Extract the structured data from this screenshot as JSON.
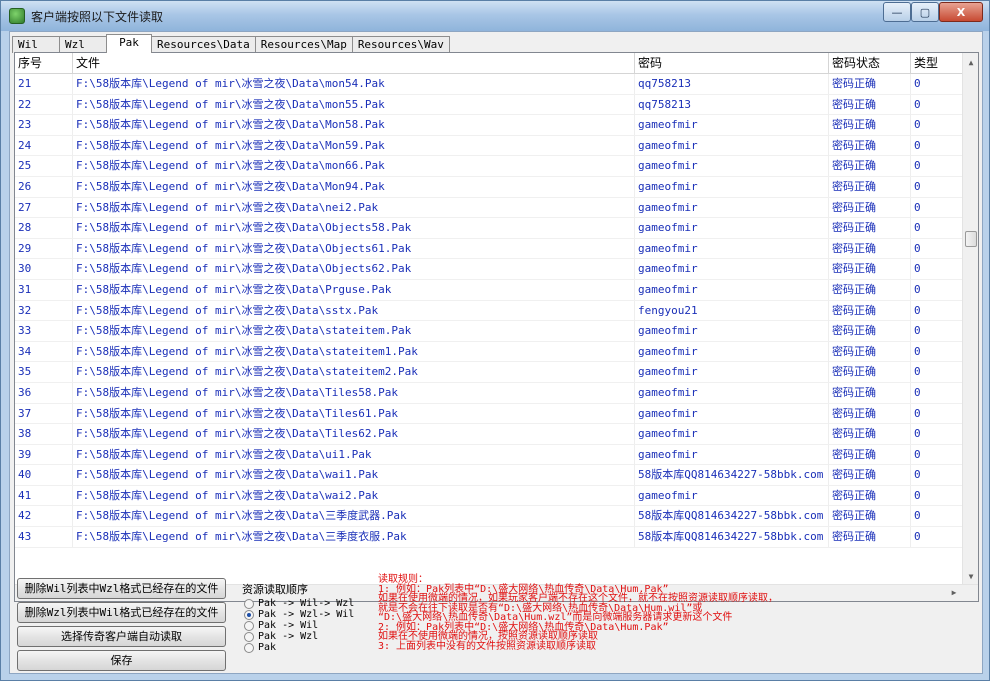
{
  "window": {
    "title": "客户端按照以下文件读取",
    "min": "—",
    "max": "▢",
    "close": "X"
  },
  "tabs": [
    "Wil",
    "Wzl",
    "Pak",
    "Resources\\Data",
    "Resources\\Map",
    "Resources\\Wav"
  ],
  "active_tab": "Pak",
  "table": {
    "columns": [
      "序号",
      "文件",
      "密码",
      "密码状态",
      "类型"
    ],
    "rows": [
      [
        "21",
        "F:\\58版本库\\Legend of mir\\冰雪之夜\\Data\\mon54.Pak",
        "qq758213",
        "密码正确",
        "0"
      ],
      [
        "22",
        "F:\\58版本库\\Legend of mir\\冰雪之夜\\Data\\mon55.Pak",
        "qq758213",
        "密码正确",
        "0"
      ],
      [
        "23",
        "F:\\58版本库\\Legend of mir\\冰雪之夜\\Data\\Mon58.Pak",
        "gameofmir",
        "密码正确",
        "0"
      ],
      [
        "24",
        "F:\\58版本库\\Legend of mir\\冰雪之夜\\Data\\Mon59.Pak",
        "gameofmir",
        "密码正确",
        "0"
      ],
      [
        "25",
        "F:\\58版本库\\Legend of mir\\冰雪之夜\\Data\\mon66.Pak",
        "gameofmir",
        "密码正确",
        "0"
      ],
      [
        "26",
        "F:\\58版本库\\Legend of mir\\冰雪之夜\\Data\\Mon94.Pak",
        "gameofmir",
        "密码正确",
        "0"
      ],
      [
        "27",
        "F:\\58版本库\\Legend of mir\\冰雪之夜\\Data\\nei2.Pak",
        "gameofmir",
        "密码正确",
        "0"
      ],
      [
        "28",
        "F:\\58版本库\\Legend of mir\\冰雪之夜\\Data\\Objects58.Pak",
        "gameofmir",
        "密码正确",
        "0"
      ],
      [
        "29",
        "F:\\58版本库\\Legend of mir\\冰雪之夜\\Data\\Objects61.Pak",
        "gameofmir",
        "密码正确",
        "0"
      ],
      [
        "30",
        "F:\\58版本库\\Legend of mir\\冰雪之夜\\Data\\Objects62.Pak",
        "gameofmir",
        "密码正确",
        "0"
      ],
      [
        "31",
        "F:\\58版本库\\Legend of mir\\冰雪之夜\\Data\\Prguse.Pak",
        "gameofmir",
        "密码正确",
        "0"
      ],
      [
        "32",
        "F:\\58版本库\\Legend of mir\\冰雪之夜\\Data\\sstx.Pak",
        "fengyou21",
        "密码正确",
        "0"
      ],
      [
        "33",
        "F:\\58版本库\\Legend of mir\\冰雪之夜\\Data\\stateitem.Pak",
        "gameofmir",
        "密码正确",
        "0"
      ],
      [
        "34",
        "F:\\58版本库\\Legend of mir\\冰雪之夜\\Data\\stateitem1.Pak",
        "gameofmir",
        "密码正确",
        "0"
      ],
      [
        "35",
        "F:\\58版本库\\Legend of mir\\冰雪之夜\\Data\\stateitem2.Pak",
        "gameofmir",
        "密码正确",
        "0"
      ],
      [
        "36",
        "F:\\58版本库\\Legend of mir\\冰雪之夜\\Data\\Tiles58.Pak",
        "gameofmir",
        "密码正确",
        "0"
      ],
      [
        "37",
        "F:\\58版本库\\Legend of mir\\冰雪之夜\\Data\\Tiles61.Pak",
        "gameofmir",
        "密码正确",
        "0"
      ],
      [
        "38",
        "F:\\58版本库\\Legend of mir\\冰雪之夜\\Data\\Tiles62.Pak",
        "gameofmir",
        "密码正确",
        "0"
      ],
      [
        "39",
        "F:\\58版本库\\Legend of mir\\冰雪之夜\\Data\\ui1.Pak",
        "gameofmir",
        "密码正确",
        "0"
      ],
      [
        "40",
        "F:\\58版本库\\Legend of mir\\冰雪之夜\\Data\\wai1.Pak",
        "58版本库QQ814634227-58bbk.com",
        "密码正确",
        "0"
      ],
      [
        "41",
        "F:\\58版本库\\Legend of mir\\冰雪之夜\\Data\\wai2.Pak",
        "gameofmir",
        "密码正确",
        "0"
      ],
      [
        "42",
        "F:\\58版本库\\Legend of mir\\冰雪之夜\\Data\\三季度武器.Pak",
        "58版本库QQ814634227-58bbk.com",
        "密码正确",
        "0"
      ],
      [
        "43",
        "F:\\58版本库\\Legend of mir\\冰雪之夜\\Data\\三季度衣服.Pak",
        "58版本库QQ814634227-58bbk.com",
        "密码正确",
        "0"
      ]
    ]
  },
  "buttons": {
    "delete_wil": "删除Wil列表中Wzl格式已经存在的文件",
    "delete_wzl": "删除Wzl列表中Wil格式已经存在的文件",
    "choose_client": "选择传奇客户端自动读取",
    "save": "保存"
  },
  "read_order": {
    "title": "资源读取顺序",
    "options": [
      "Pak -> Wil-> Wzl",
      "Pak -> Wzl-> Wil",
      "Pak -> Wil",
      "Pak -> Wzl",
      "Pak"
    ],
    "selected_index": 1
  },
  "rules": [
    "读取规则：",
    "1: 例如：Pak列表中“D:\\盛大网络\\热血传奇\\Data\\Hum.Pak”",
    "     如果在使用微端的情况，如果玩家客户端不存在这个文件，就不在按照资源读取顺序读取，",
    "     就是不会在往下读取是否有“D:\\盛大网络\\热血传奇\\Data\\Hum.wil”或",
    "   “D:\\盛大网络\\热血传奇\\Data\\Hum.wzl”而是向微端服务器请求更新这个文件",
    "2: 例如：Pak列表中“D:\\盛大网络\\热血传奇\\Data\\Hum.Pak”",
    "     如果在不使用微端的情况，按照资源读取顺序读取",
    "3: 上面列表中没有的文件按照资源读取顺序读取"
  ],
  "colors": {
    "row_text": "#1a2fb8",
    "rules_text": "#e01010",
    "title_bar": "#a9c6e6"
  }
}
